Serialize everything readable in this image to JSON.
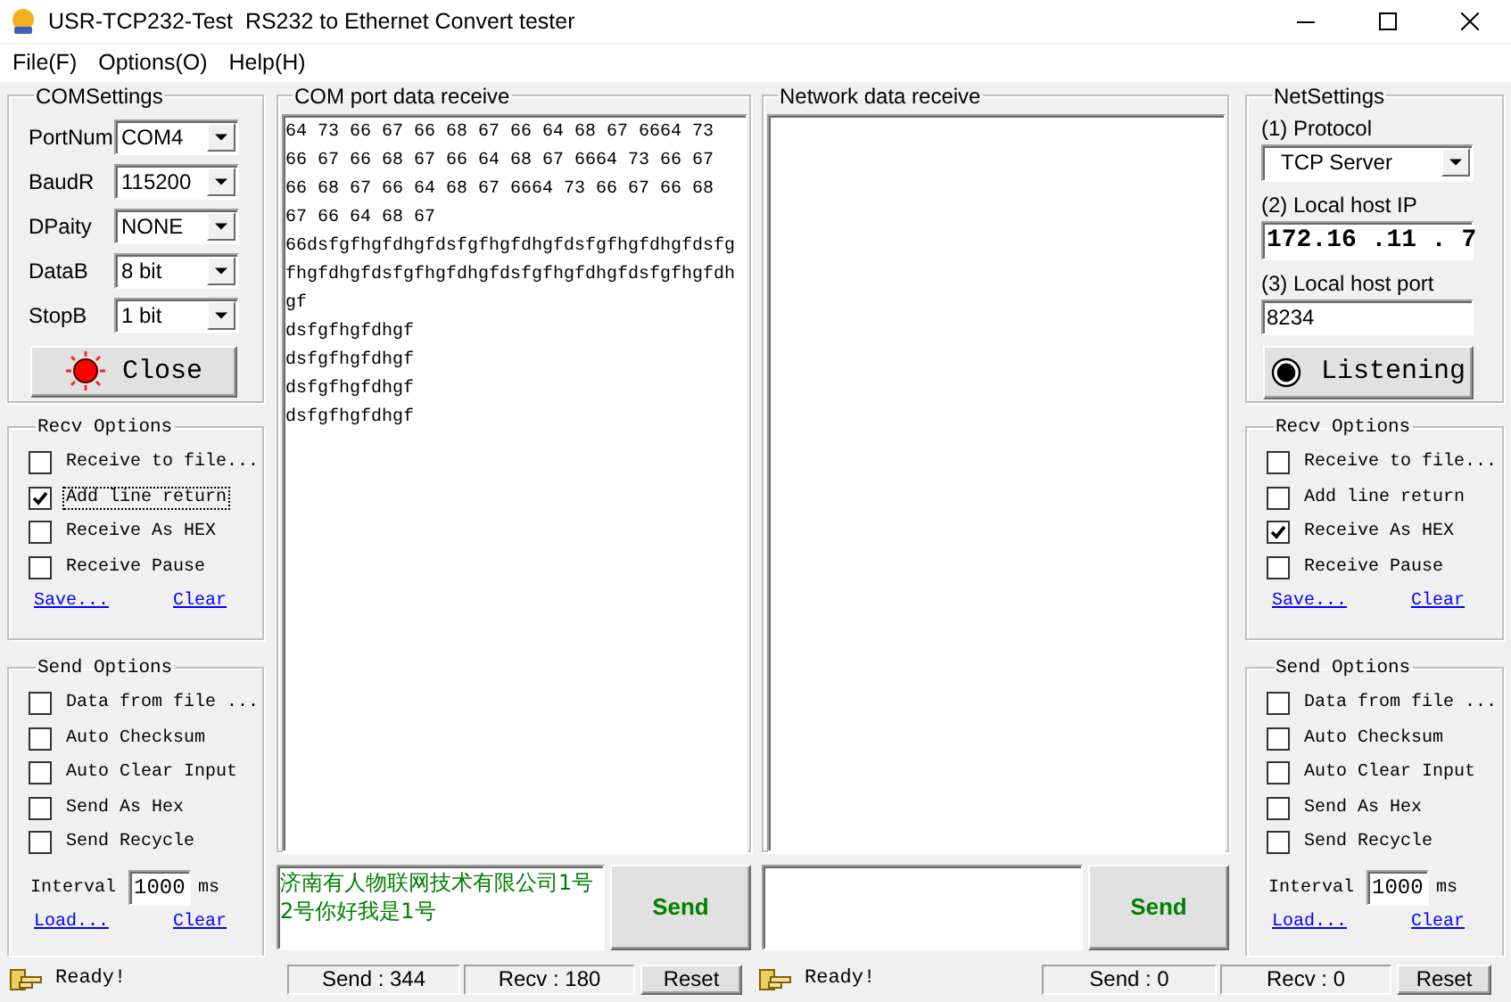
{
  "window": {
    "title": "USR-TCP232-Test  RS232 to Ethernet Convert tester"
  },
  "menu": [
    "File(F)",
    "Options(O)",
    "Help(H)"
  ],
  "com_settings": {
    "title": "COMSettings",
    "fields": [
      {
        "label": "PortNum",
        "value": "COM4"
      },
      {
        "label": "BaudR",
        "value": "115200"
      },
      {
        "label": "DPaity",
        "value": "NONE"
      },
      {
        "label": "DataB",
        "value": "8 bit"
      },
      {
        "label": "StopB",
        "value": "1 bit"
      }
    ],
    "button": {
      "label": "Close",
      "lit": true
    }
  },
  "com_recv_options": {
    "title": "Recv Options",
    "options": [
      {
        "label": "Receive to file...",
        "checked": false,
        "focused": false
      },
      {
        "label": "Add line return",
        "checked": true,
        "focused": true
      },
      {
        "label": "Receive As HEX",
        "checked": false,
        "focused": false
      },
      {
        "label": "Receive Pause",
        "checked": false,
        "focused": false
      }
    ],
    "links": [
      "Save...",
      "Clear"
    ]
  },
  "com_send_options": {
    "title": "Send Options",
    "options": [
      {
        "label": "Data from file ...",
        "checked": false,
        "focused": false
      },
      {
        "label": "Auto Checksum",
        "checked": false,
        "focused": false
      },
      {
        "label": "Auto Clear Input",
        "checked": false,
        "focused": false
      },
      {
        "label": "Send As Hex",
        "checked": false,
        "focused": false
      },
      {
        "label": "Send Recycle",
        "checked": false,
        "focused": false
      }
    ],
    "interval": {
      "label": "Interval",
      "value": "1000",
      "unit": "ms"
    },
    "links": [
      "Load...",
      "Clear"
    ]
  },
  "com_receive": {
    "title": "COM port data receive",
    "lines": [
      "64 73 66 67 66 68 67 66 64 68 67 6664 73",
      "66 67 66 68 67 66 64 68 67 6664 73 66 67",
      "66 68 67 66 64 68 67 6664 73 66 67 66 68",
      "67 66 64 68 67",
      "66dsfgfhgfdhgfdsfgfhgfdhgfdsfgfhgfdhgfdsfg",
      "fhgfdhgfdsfgfhgfdhgfdsfgfhgfdhgfdsfgfhgfdh",
      "gf",
      "dsfgfhgfdhgf",
      "dsfgfhgfdhgf",
      "dsfgfhgfdhgf",
      "dsfgfhgfdhgf"
    ],
    "input": [
      "济南有人物联网技术有限公司1号",
      "2号你好我是1号"
    ],
    "send_button": "Send"
  },
  "net_receive": {
    "title": "Network data receive",
    "send_button": "Send"
  },
  "net_settings": {
    "title": "NetSettings",
    "protocol": {
      "label": "(1) Protocol",
      "value": "TCP Server"
    },
    "ip": {
      "label": "(2) Local host IP",
      "value": "172.16 .11 . 7"
    },
    "port": {
      "label": "(3) Local host port",
      "value": "8234"
    },
    "button": {
      "label": "Listening",
      "lit": false
    }
  },
  "net_recv_options": {
    "title": "Recv Options",
    "options": [
      {
        "label": "Receive to file...",
        "checked": false,
        "focused": false
      },
      {
        "label": "Add line return",
        "checked": false,
        "focused": false
      },
      {
        "label": "Receive As HEX",
        "checked": true,
        "focused": false
      },
      {
        "label": "Receive Pause",
        "checked": false,
        "focused": false
      }
    ],
    "links": [
      "Save...",
      "Clear"
    ]
  },
  "net_send_options": {
    "title": "Send Options",
    "options": [
      {
        "label": "Data from file ...",
        "checked": false,
        "focused": false
      },
      {
        "label": "Auto Checksum",
        "checked": false,
        "focused": false
      },
      {
        "label": "Auto Clear Input",
        "checked": false,
        "focused": false
      },
      {
        "label": "Send As Hex",
        "checked": false,
        "focused": false
      },
      {
        "label": "Send Recycle",
        "checked": false,
        "focused": false
      }
    ],
    "interval": {
      "label": "Interval",
      "value": "1000",
      "unit": "ms"
    },
    "links": [
      "Load...",
      "Clear"
    ]
  },
  "com_status": {
    "text": "Ready!",
    "send": "Send : 344",
    "recv": "Recv : 180",
    "reset": "Reset"
  },
  "net_status": {
    "text": "Ready!",
    "send": "Send : 0",
    "recv": "Recv : 0",
    "reset": "Reset"
  }
}
